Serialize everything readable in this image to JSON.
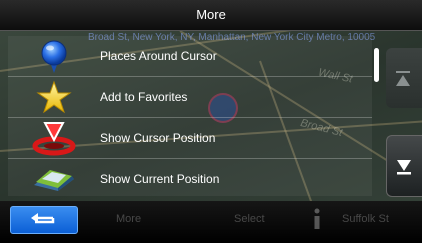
{
  "header": {
    "title": "More"
  },
  "background": {
    "address_line": "Broad St, New York, NY, Manhattan, New York City Metro, 10005",
    "map_labels": [
      "Wall St",
      "Broad St"
    ]
  },
  "menu": {
    "items": [
      {
        "label": "Places Around Cursor",
        "icon": "blue-pin-icon"
      },
      {
        "label": "Add to Favorites",
        "icon": "star-icon"
      },
      {
        "label": "Show Cursor Position",
        "icon": "cursor-position-icon"
      },
      {
        "label": "Show Current Position",
        "icon": "car-arrow-icon"
      }
    ]
  },
  "bottom_bar": {
    "back_icon": "back-arrow-icon",
    "ghost_labels": [
      "More",
      "Select",
      "Suffolk St"
    ]
  },
  "colors": {
    "accent": "#1a6fe0",
    "title_text": "#ffffff",
    "row_divider": "#ffffff"
  }
}
